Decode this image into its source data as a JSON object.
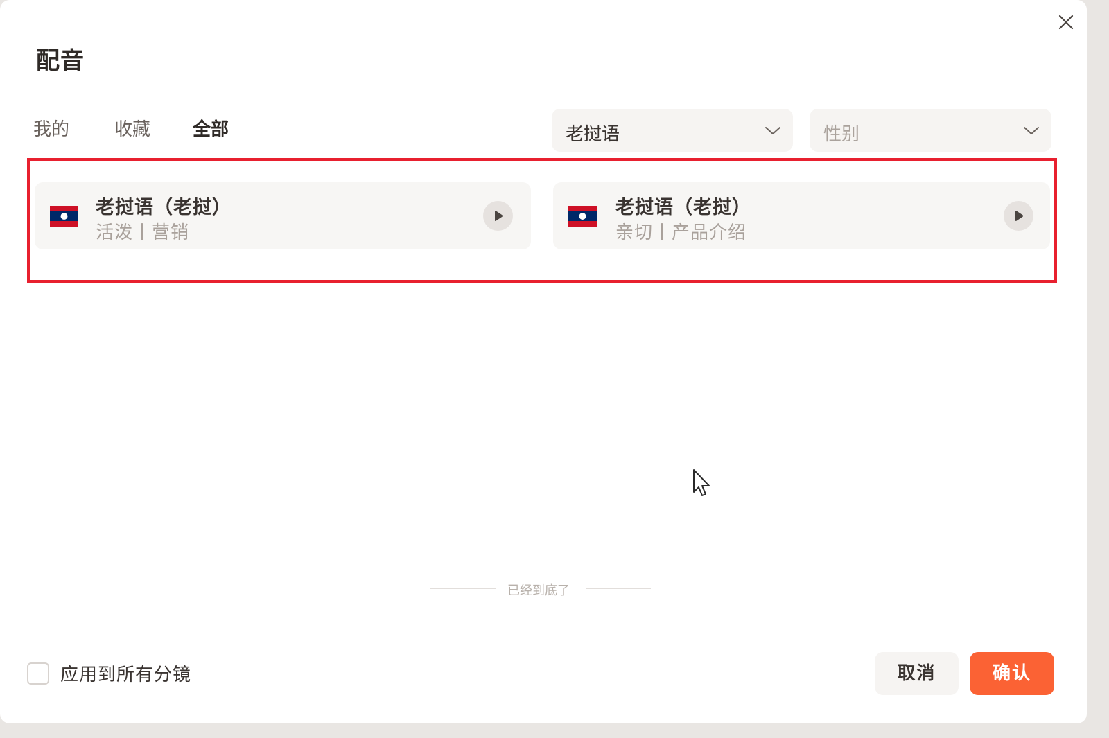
{
  "dialog": {
    "title": "配音",
    "close_icon": "close-icon"
  },
  "tabs": [
    {
      "label": "我的",
      "active": false
    },
    {
      "label": "收藏",
      "active": false
    },
    {
      "label": "全部",
      "active": true
    }
  ],
  "filters": {
    "language": {
      "value": "老挝语",
      "icon": "chevron-down-icon"
    },
    "gender": {
      "placeholder": "性别",
      "icon": "chevron-down-icon"
    }
  },
  "voices": [
    {
      "name": "老挝语（老挝）",
      "tags": "活泼丨营销",
      "flag": "laos-flag-icon",
      "play_icon": "play-icon"
    },
    {
      "name": "老挝语（老挝）",
      "tags": "亲切丨产品介绍",
      "flag": "laos-flag-icon",
      "play_icon": "play-icon"
    }
  ],
  "list_end_text": "已经到底了",
  "footer": {
    "apply_all_label": "应用到所有分镜",
    "apply_all_checked": false,
    "cancel_label": "取消",
    "confirm_label": "确认"
  },
  "colors": {
    "accent": "#fb6234",
    "highlight_border": "#e8202f",
    "card_bg": "#f7f6f4"
  }
}
